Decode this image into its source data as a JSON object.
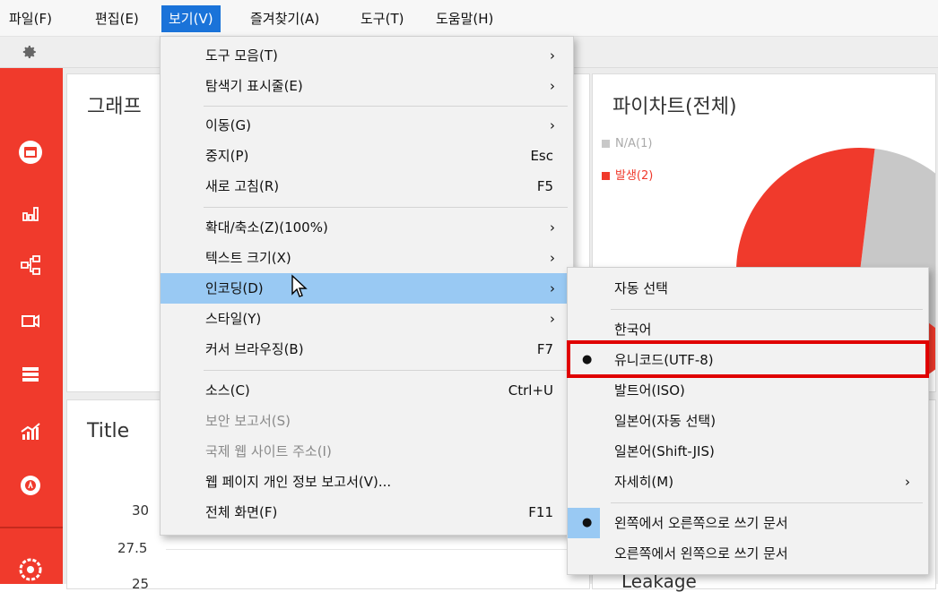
{
  "menubar": {
    "items": [
      "파일(F)",
      "편집(E)",
      "보기(V)",
      "즐겨찾기(A)",
      "도구(T)",
      "도움말(H)"
    ],
    "active_index": 2
  },
  "dashboard": {
    "graph_panel_title": "그래프",
    "pie_panel_title": "파이차트(전체)",
    "pie_legend": [
      {
        "label": "N/A(1)",
        "color": "#c8c8c8"
      },
      {
        "label": "발생(2)",
        "color": "#f03a2c"
      }
    ],
    "pie_values": [
      1,
      2
    ],
    "title_panel_title": "Title",
    "y_ticks": [
      "30",
      "27.5",
      "25"
    ],
    "bottom_right_text": "Leakage"
  },
  "view_menu": {
    "items": [
      {
        "label": "도구 모음(T)",
        "shortcut": "",
        "submenu": true
      },
      {
        "label": "탐색기 표시줄(E)",
        "shortcut": "",
        "submenu": true
      },
      {
        "label": "이동(G)",
        "shortcut": "",
        "submenu": true
      },
      {
        "label": "중지(P)",
        "shortcut": "Esc",
        "submenu": false
      },
      {
        "label": "새로 고침(R)",
        "shortcut": "F5",
        "submenu": false
      },
      {
        "label": "확대/축소(Z)(100%)",
        "shortcut": "",
        "submenu": true
      },
      {
        "label": "텍스트 크기(X)",
        "shortcut": "",
        "submenu": true
      },
      {
        "label": "인코딩(D)",
        "shortcut": "",
        "submenu": true
      },
      {
        "label": "스타일(Y)",
        "shortcut": "",
        "submenu": true
      },
      {
        "label": "커서 브라우징(B)",
        "shortcut": "F7",
        "submenu": false
      },
      {
        "label": "소스(C)",
        "shortcut": "Ctrl+U",
        "submenu": false
      },
      {
        "label": "보안 보고서(S)",
        "shortcut": "",
        "submenu": false
      },
      {
        "label": "국제 웹 사이트 주소(I)",
        "shortcut": "",
        "submenu": false
      },
      {
        "label": "웹 페이지 개인 정보 보고서(V)...",
        "shortcut": "",
        "submenu": false
      },
      {
        "label": "전체 화면(F)",
        "shortcut": "F11",
        "submenu": false
      }
    ],
    "highlighted": "인코딩(D)",
    "disabled": [
      "보안 보고서(S)",
      "국제 웹 사이트 주소(I)"
    ]
  },
  "encoding_menu": {
    "items": [
      {
        "label": "자동 선택"
      },
      {
        "label": "한국어"
      },
      {
        "label": "유니코드(UTF-8)",
        "selected": true
      },
      {
        "label": "발트어(ISO)"
      },
      {
        "label": "일본어(자동 선택)"
      },
      {
        "label": "일본어(Shift-JIS)"
      },
      {
        "label": "자세히(M)",
        "submenu": true
      },
      {
        "label": "왼쪽에서 오른쪽으로 쓰기 문서",
        "selected": true
      },
      {
        "label": "오른쪽에서 왼쪽으로 쓰기 문서"
      }
    ],
    "bullet": "●",
    "arrow": "›"
  },
  "colors": {
    "accent_red": "#f03a2c",
    "menu_highlight": "#99c9f3",
    "menubar_active": "#1a73d9",
    "annotation_box": "#e00000"
  }
}
